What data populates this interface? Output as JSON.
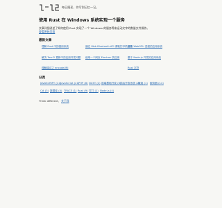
{
  "site": {
    "logo_text": "记一记",
    "slogan": "每日随读，你写到记忆一记。"
  },
  "article": {
    "title": "使用 Rust 在 Windows 系统实现一个服务",
    "intro": "文章详细讲述了如何使用 Rust 实现了一个 Windows 的服务等来运动文字的数量文件操作。",
    "view_original": "查看原始页面"
  },
  "recent": {
    "heading": "最新文章",
    "rows": [
      [
        "理解 Rust 中的借用系统",
        "通过 Web Bluetooth API 请取打印机信息",
        "使用 WebGPU 进程的应用系统"
      ],
      [
        "解决 Tauri2 更新中的应用开发问题",
        "使用一个网页 Electron 的应用",
        "基于 Node.js 开发的应用系统"
      ],
      [
        "理解调试之 encodeURI",
        "",
        "Rust 字符"
      ]
    ]
  },
  "categories": {
    "heading": "分类",
    "rows": [
      [
        "JAVASCRIPT (11)",
        "JavaScript (21)",
        "PHP (8)",
        "NUXT (2)",
        "前端基础开发 (6)",
        "前后开发系统 (2)",
        "数组 (1)",
        "服务器 (14)"
      ],
      [
        "C# (3)",
        "数据库 (4)",
        "TRACE (1)",
        "Rust (9)",
        "打打 (1)",
        "Node.js (4)"
      ]
    ]
  },
  "footer": {
    "text": "Think different,",
    "link": "关于我"
  }
}
